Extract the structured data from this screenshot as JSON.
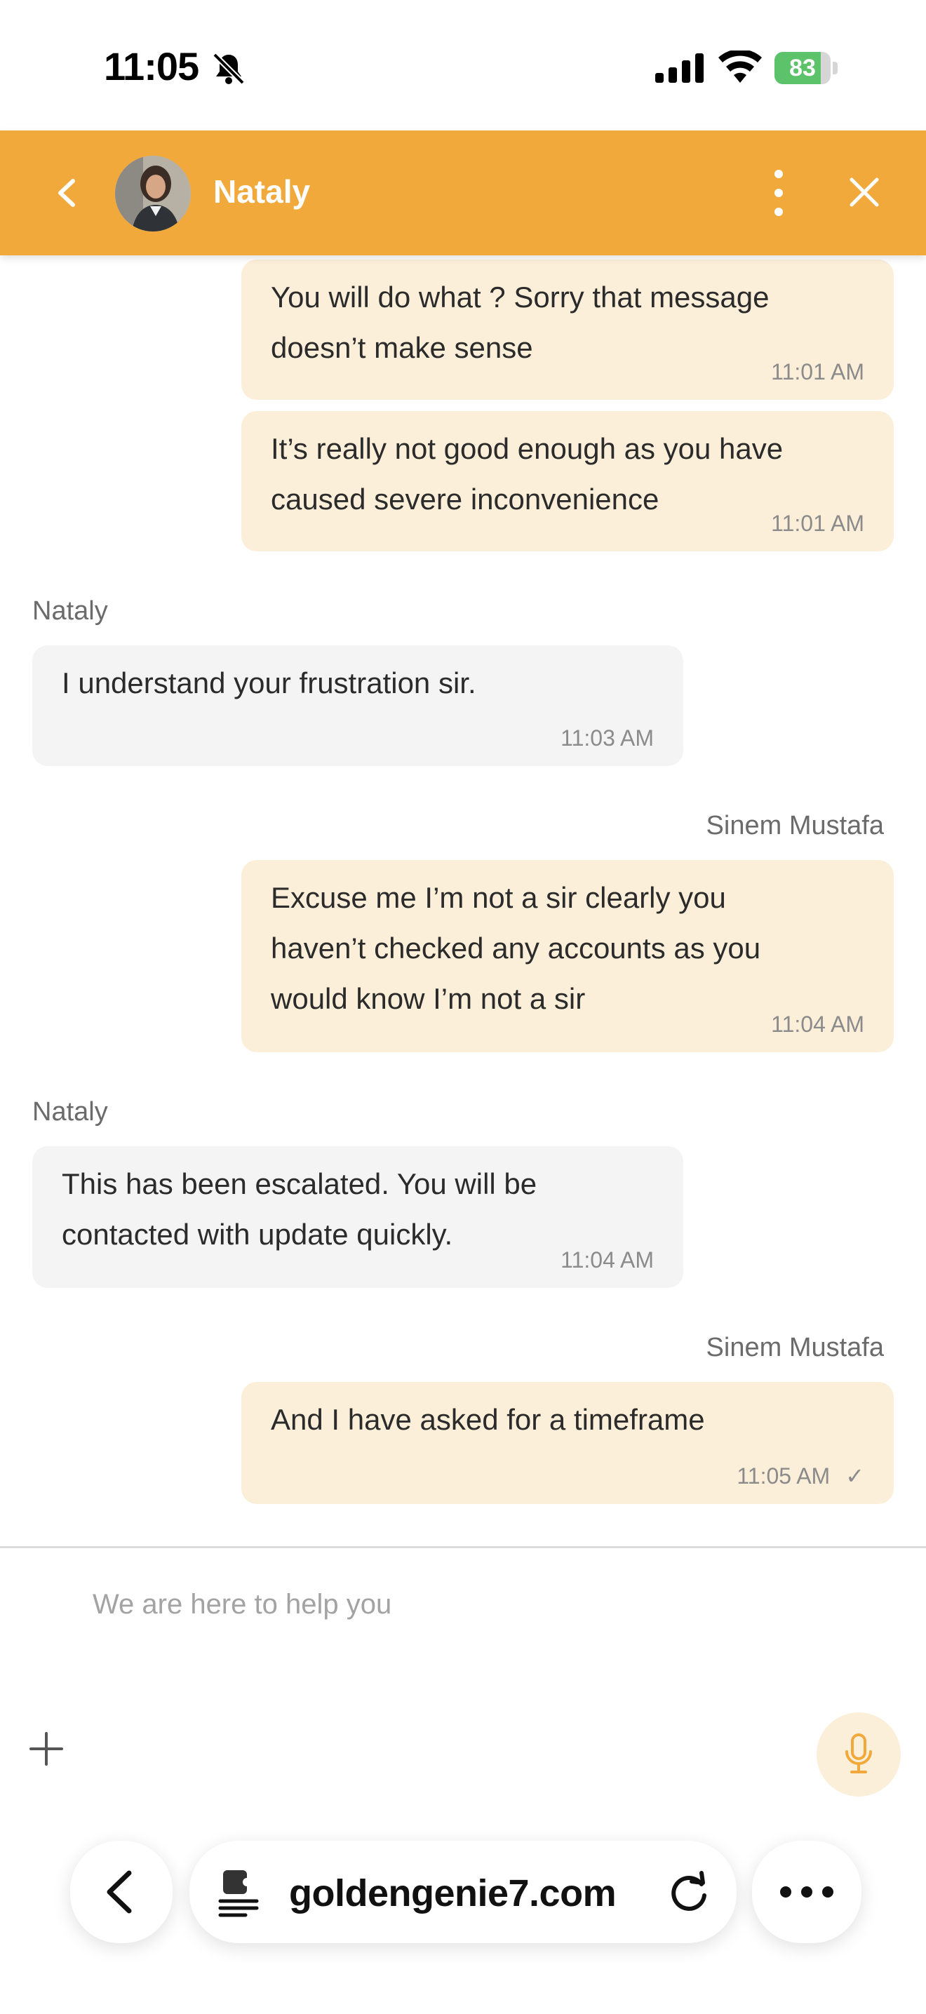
{
  "status_bar": {
    "time": "11:05",
    "battery": "83",
    "battery_level": 0.83
  },
  "header": {
    "name": "Nataly"
  },
  "messages": [
    {
      "dir": "out",
      "text_lines": [
        "You will do what ? Sorry that message",
        "doesn’t make sense"
      ],
      "time": "11:01 AM"
    },
    {
      "dir": "out",
      "text_lines": [
        "It’s really not good enough as you have",
        "caused severe inconvenience"
      ],
      "time": "11:01 AM"
    },
    {
      "dir": "in",
      "sender": "Nataly",
      "text_lines": [
        "I understand your frustration sir."
      ],
      "time": "11:03 AM"
    },
    {
      "dir": "out",
      "sender": "Sinem Mustafa",
      "text_lines": [
        "Excuse me I’m not a sir clearly you",
        "haven’t checked any accounts as you",
        "would know I’m not a sir"
      ],
      "time": "11:04 AM"
    },
    {
      "dir": "in",
      "sender": "Nataly",
      "text_lines": [
        "This has been escalated. You will be",
        "contacted with update quickly."
      ],
      "time": "11:04 AM"
    },
    {
      "dir": "out",
      "sender": "Sinem Mustafa",
      "text_lines": [
        "And I have asked for a timeframe"
      ],
      "time": "11:05 AM",
      "status": "✓"
    }
  ],
  "composer": {
    "placeholder": "We are here to help you"
  },
  "browser": {
    "url": "goldengenie7.com"
  },
  "colors": {
    "header": "#f1a93c",
    "outgoing_bubble": "#fcefd9",
    "incoming_bubble": "#f4f4f4",
    "mic": "#f1a93c"
  }
}
